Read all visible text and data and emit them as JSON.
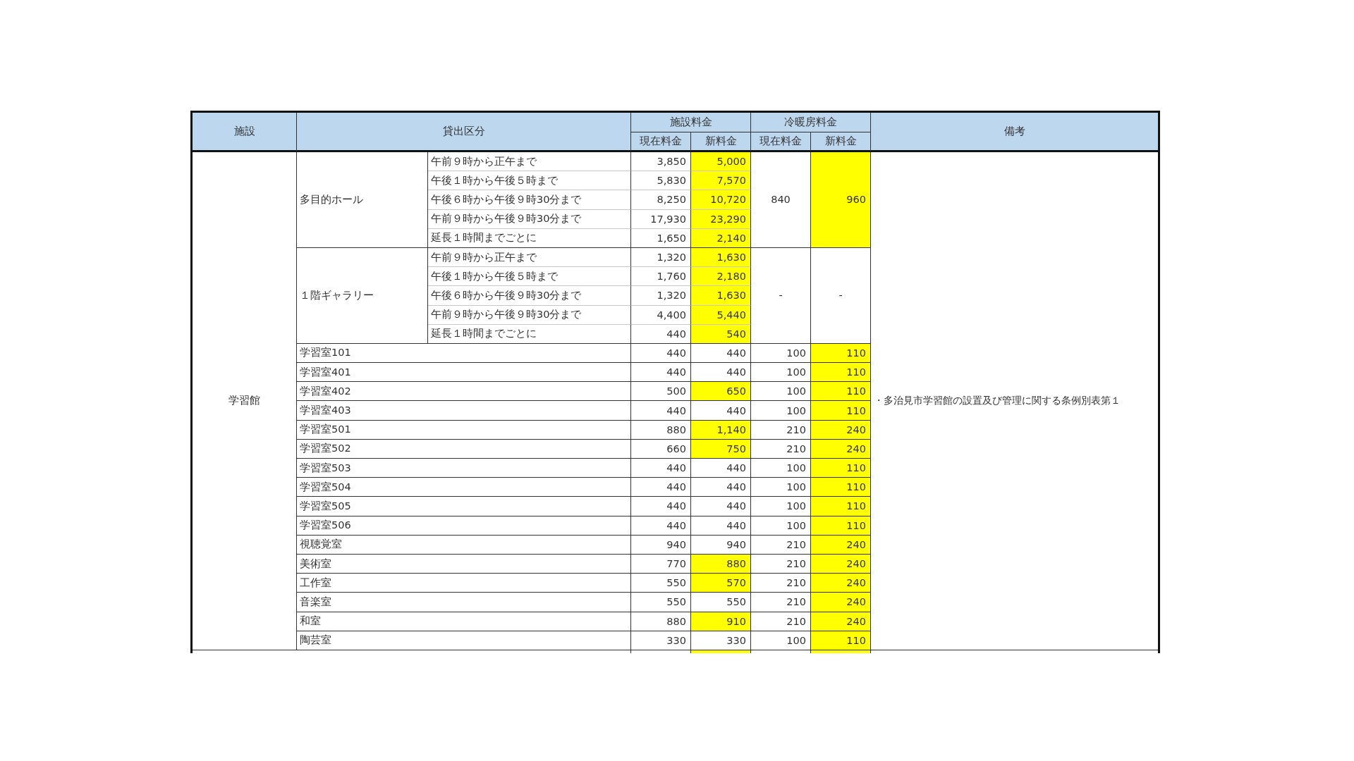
{
  "header": {
    "facility": "施設",
    "category": "貸出区分",
    "facility_fee": "施設料金",
    "hvac_fee": "冷暖房料金",
    "facility_current": "現在料金",
    "facility_new": "新料金",
    "hvac_current": "現在料金",
    "hvac_new": "新料金",
    "remarks": "備考"
  },
  "facility_name": "学習館",
  "remark": "・多治見市学習館の設置及び管理に関する条例別表第１",
  "groups": [
    {
      "name": "多目的ホール",
      "hvac_current": "840",
      "hvac_new": "960",
      "hvac_changed": true,
      "slots": [
        {
          "label": "午前９時から正午まで",
          "current": "3,850",
          "new": "5,000",
          "changed": true
        },
        {
          "label": "午後１時から午後５時まで",
          "current": "5,830",
          "new": "7,570",
          "changed": true
        },
        {
          "label": "午後６時から午後９時30分まで",
          "current": "8,250",
          "new": "10,720",
          "changed": true
        },
        {
          "label": "午前９時から午後９時30分まで",
          "current": "17,930",
          "new": "23,290",
          "changed": true
        },
        {
          "label": "延長１時間までごとに",
          "current": "1,650",
          "new": "2,140",
          "changed": true
        }
      ]
    },
    {
      "name": "１階ギャラリー",
      "hvac_current": "-",
      "hvac_new": "-",
      "hvac_changed": false,
      "slots": [
        {
          "label": "午前９時から正午まで",
          "current": "1,320",
          "new": "1,630",
          "changed": true
        },
        {
          "label": "午後１時から午後５時まで",
          "current": "1,760",
          "new": "2,180",
          "changed": true
        },
        {
          "label": "午後６時から午後９時30分まで",
          "current": "1,320",
          "new": "1,630",
          "changed": true
        },
        {
          "label": "午前９時から午後９時30分まで",
          "current": "4,400",
          "new": "5,440",
          "changed": true
        },
        {
          "label": "延長１時間までごとに",
          "current": "440",
          "new": "540",
          "changed": true
        }
      ]
    }
  ],
  "rooms": [
    {
      "name": "学習室101",
      "current": "440",
      "new": "440",
      "changed": false,
      "hvac_current": "100",
      "hvac_new": "110",
      "hvac_changed": true
    },
    {
      "name": "学習室401",
      "current": "440",
      "new": "440",
      "changed": false,
      "hvac_current": "100",
      "hvac_new": "110",
      "hvac_changed": true
    },
    {
      "name": "学習室402",
      "current": "500",
      "new": "650",
      "changed": true,
      "hvac_current": "100",
      "hvac_new": "110",
      "hvac_changed": true
    },
    {
      "name": "学習室403",
      "current": "440",
      "new": "440",
      "changed": false,
      "hvac_current": "100",
      "hvac_new": "110",
      "hvac_changed": true
    },
    {
      "name": "学習室501",
      "current": "880",
      "new": "1,140",
      "changed": true,
      "hvac_current": "210",
      "hvac_new": "240",
      "hvac_changed": true
    },
    {
      "name": "学習室502",
      "current": "660",
      "new": "750",
      "changed": true,
      "hvac_current": "210",
      "hvac_new": "240",
      "hvac_changed": true
    },
    {
      "name": "学習室503",
      "current": "440",
      "new": "440",
      "changed": false,
      "hvac_current": "100",
      "hvac_new": "110",
      "hvac_changed": true
    },
    {
      "name": "学習室504",
      "current": "440",
      "new": "440",
      "changed": false,
      "hvac_current": "100",
      "hvac_new": "110",
      "hvac_changed": true
    },
    {
      "name": "学習室505",
      "current": "440",
      "new": "440",
      "changed": false,
      "hvac_current": "100",
      "hvac_new": "110",
      "hvac_changed": true
    },
    {
      "name": "学習室506",
      "current": "440",
      "new": "440",
      "changed": false,
      "hvac_current": "100",
      "hvac_new": "110",
      "hvac_changed": true
    },
    {
      "name": "視聴覚室",
      "current": "940",
      "new": "940",
      "changed": false,
      "hvac_current": "210",
      "hvac_new": "240",
      "hvac_changed": true
    },
    {
      "name": "美術室",
      "current": "770",
      "new": "880",
      "changed": true,
      "hvac_current": "210",
      "hvac_new": "240",
      "hvac_changed": true
    },
    {
      "name": "工作室",
      "current": "550",
      "new": "570",
      "changed": true,
      "hvac_current": "210",
      "hvac_new": "240",
      "hvac_changed": true
    },
    {
      "name": "音楽室",
      "current": "550",
      "new": "550",
      "changed": false,
      "hvac_current": "210",
      "hvac_new": "240",
      "hvac_changed": true
    },
    {
      "name": "和室",
      "current": "880",
      "new": "910",
      "changed": true,
      "hvac_current": "210",
      "hvac_new": "240",
      "hvac_changed": true
    },
    {
      "name": "陶芸室",
      "current": "330",
      "new": "330",
      "changed": false,
      "hvac_current": "100",
      "hvac_new": "110",
      "hvac_changed": true
    }
  ],
  "cut_row": {
    "changed": true,
    "hvac_changed": true
  }
}
